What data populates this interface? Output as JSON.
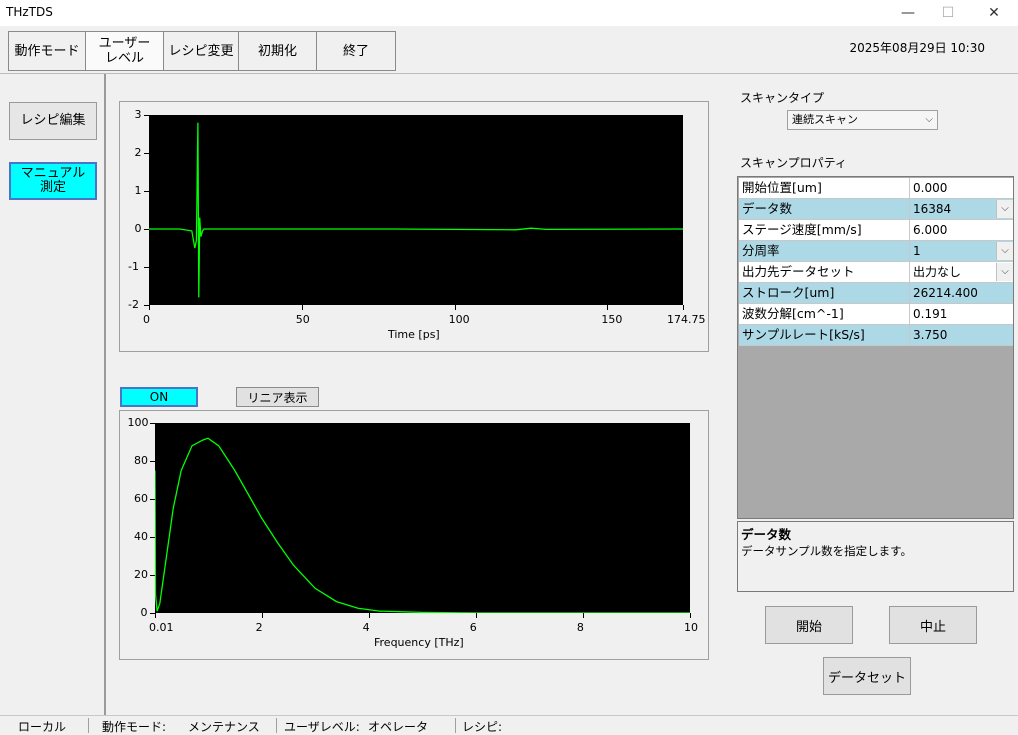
{
  "window": {
    "title": "THzTDS",
    "minimize": "—",
    "maximize": "☐",
    "close": "✕"
  },
  "toolbar": {
    "items": [
      "動作モード",
      "ユーザー\nレベル",
      "レシピ変更",
      "初期化",
      "終了"
    ]
  },
  "datetime": "2025年08月29日 10:30",
  "left_panel": {
    "recipe_edit": "レシピ編集",
    "manual_measure": "マニュアル\n測定"
  },
  "time_plot": {
    "xlabel": "Time [ps]",
    "xticks": [
      "0",
      "50",
      "100",
      "150",
      "174.75"
    ],
    "yticks": [
      "3",
      "2",
      "1",
      "0",
      "-1",
      "-2"
    ]
  },
  "freq_plot": {
    "on_button": "ON",
    "linear_button": "リニア表示",
    "xlabel": "Frequency [THz]",
    "xticks": [
      "0.01",
      "2",
      "4",
      "6",
      "8",
      "10"
    ],
    "yticks": [
      "100",
      "80",
      "60",
      "40",
      "20",
      "0"
    ]
  },
  "chart_data": [
    {
      "type": "line",
      "xlabel": "Time [ps]",
      "ylabel": "",
      "xlim": [
        0,
        174.75
      ],
      "ylim": [
        -2,
        3
      ],
      "series": [
        {
          "color": "#00ff00",
          "x": [
            0,
            10,
            14,
            15,
            15.5,
            16,
            16.3,
            16.6,
            17,
            17.5,
            18,
            20,
            25,
            40,
            80,
            120,
            125,
            130,
            174.75
          ],
          "y": [
            0,
            0,
            -0.05,
            -0.5,
            -0.3,
            2.8,
            -1.8,
            0.3,
            -0.2,
            -0.05,
            0,
            0,
            0,
            0,
            0,
            -0.02,
            0.02,
            -0.01,
            0
          ]
        }
      ]
    },
    {
      "type": "line",
      "xlabel": "Frequency [THz]",
      "ylabel": "",
      "xlim": [
        0.01,
        10
      ],
      "ylim": [
        0,
        100
      ],
      "series": [
        {
          "color": "#00ff00",
          "x": [
            0.01,
            0.02,
            0.05,
            0.1,
            0.2,
            0.35,
            0.5,
            0.7,
            0.9,
            1.0,
            1.2,
            1.5,
            1.8,
            2.0,
            2.3,
            2.6,
            3.0,
            3.4,
            3.8,
            4.2,
            5,
            6,
            8,
            10
          ],
          "y": [
            75,
            10,
            1,
            5,
            25,
            55,
            75,
            88,
            91,
            92,
            88,
            75,
            60,
            50,
            37,
            25,
            13,
            6,
            2.5,
            1,
            0.3,
            0,
            0,
            0
          ]
        }
      ]
    }
  ],
  "scan_type": {
    "label": "スキャンタイプ",
    "value": "連続スキャン"
  },
  "scan_props": {
    "label": "スキャンプロパティ",
    "rows": [
      {
        "key": "開始位置[um]",
        "value": "0.000",
        "dropdown": false,
        "style": "white"
      },
      {
        "key": "データ数",
        "value": "16384",
        "dropdown": true,
        "style": "blue"
      },
      {
        "key": "ステージ速度[mm/s]",
        "value": "6.000",
        "dropdown": false,
        "style": "white"
      },
      {
        "key": "分周率",
        "value": "1",
        "dropdown": true,
        "style": "blue"
      },
      {
        "key": "出力先データセット",
        "value": "出力なし",
        "dropdown": true,
        "style": "white"
      },
      {
        "key": "ストローク[um]",
        "value": "26214.400",
        "dropdown": false,
        "style": "blue"
      },
      {
        "key": "波数分解[cm^-1]",
        "value": "0.191",
        "dropdown": false,
        "style": "white"
      },
      {
        "key": "サンプルレート[kS/s]",
        "value": "3.750",
        "dropdown": false,
        "style": "blue"
      }
    ]
  },
  "description": {
    "title": "データ数",
    "text": "データサンプル数を指定します。"
  },
  "actions": {
    "start": "開始",
    "stop": "中止",
    "dataset": "データセット"
  },
  "status": {
    "location": "ローカル",
    "mode_label": "動作モード:",
    "mode_value": "メンテナンス",
    "user_label": "ユーザレベル:",
    "user_value": "オペレータ",
    "recipe_label": "レシピ:"
  }
}
